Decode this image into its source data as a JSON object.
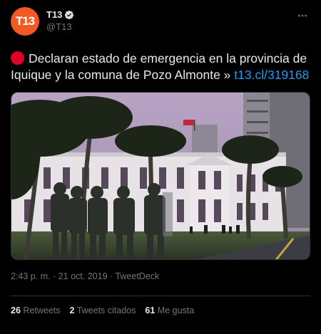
{
  "tweet": {
    "avatar_text": "T13",
    "display_name": "T13",
    "handle": "@T13",
    "more_icon": "ellipsis-icon",
    "verified_icon": "verified-badge-icon",
    "text_before_link": "Declaran estado de emergencia en la provincia de Iquique y la comuna de Pozo Almonte »",
    "link_text": "t13.cl/319168",
    "time": "2:43 p. m.",
    "separator": "·",
    "date": "21 oct. 2019",
    "source": "TweetDeck",
    "stats": {
      "retweets_count": "26",
      "retweets_label": "Retweets",
      "quotes_count": "2",
      "quotes_label": "Tweets citados",
      "likes_count": "61",
      "likes_label": "Me gusta"
    },
    "colors": {
      "background": "#000000",
      "brand": "#f15a22",
      "link": "#1d9bf0",
      "alert_dot": "#e0002a",
      "muted": "#71767b"
    }
  }
}
